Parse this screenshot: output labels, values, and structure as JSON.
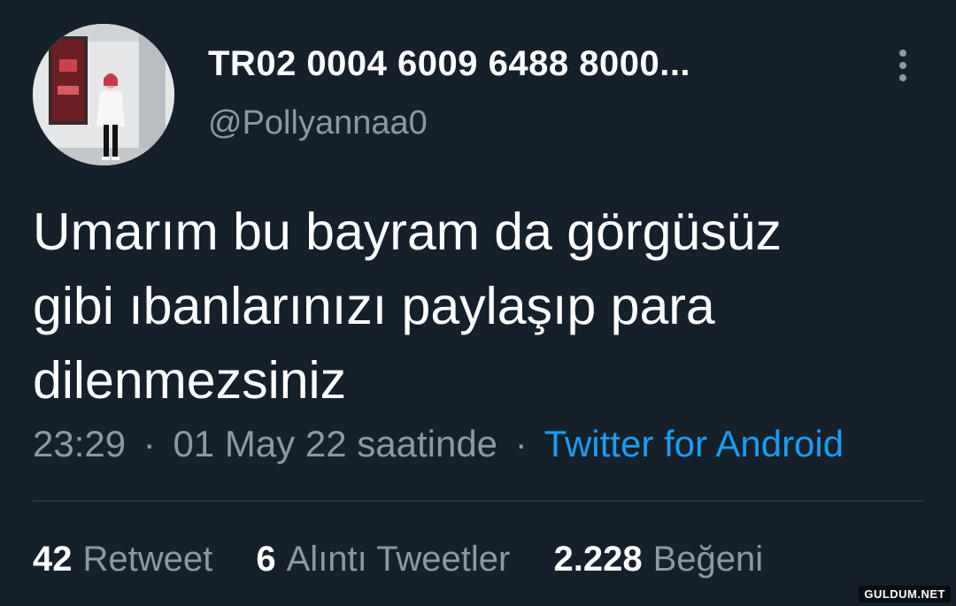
{
  "tweet": {
    "display_name": "TR02 0004 6009 6488 8000...",
    "handle": "@Pollyannaa0",
    "avatar": "profile-photo",
    "text": "Umarım bu bayram da görgüsüz\ngibi ıbanlarınızı paylaşıp para\ndilenmezsiniz",
    "time": "23:29",
    "date": "01 May 22 saatinde",
    "separator": "·",
    "source": "Twitter for Android"
  },
  "stats": {
    "retweets_count": "42",
    "retweets_label": "Retweet",
    "quotes_count": "6",
    "quotes_label": "Alıntı Tweetler",
    "likes_count": "2.228",
    "likes_label": "Beğeni"
  },
  "watermark": "GULDUM.NET",
  "colors": {
    "background": "#15202b",
    "primary_text": "#ffffff",
    "secondary_text": "#8b98a5",
    "link": "#1d9bf0",
    "divider": "#38444d"
  }
}
